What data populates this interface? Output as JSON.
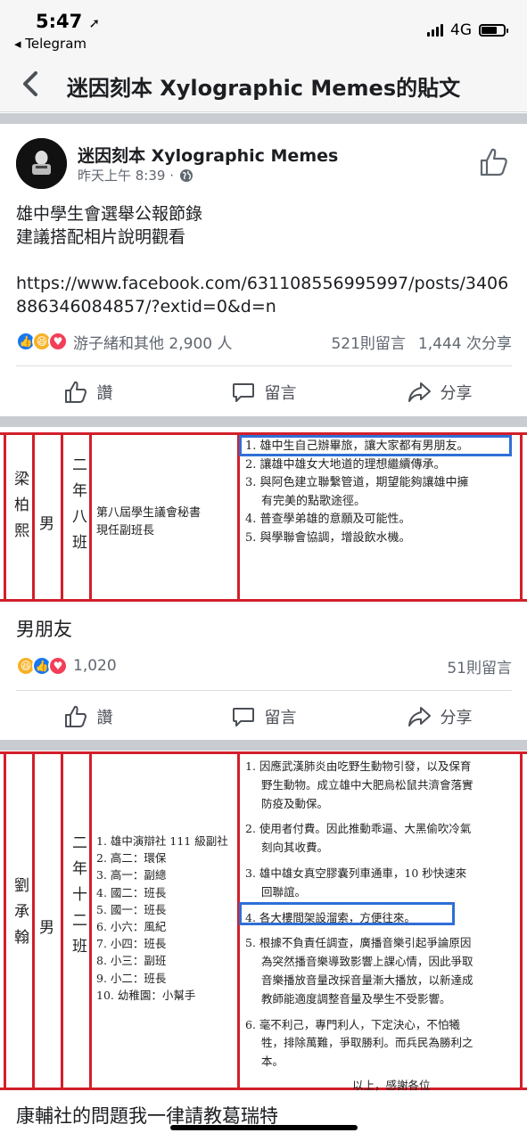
{
  "status": {
    "time": "5:47",
    "back_app": "◂ Telegram",
    "network": "4G"
  },
  "nav": {
    "title": "迷因刻本 Xylographic Memes的貼文"
  },
  "post": {
    "page_name": "迷因刻本 Xylographic Memes",
    "timestamp": "昨天上午 8:39 ·",
    "text_line1": "雄中學生會選舉公報節錄",
    "text_line2": "建議搭配相片說明觀看",
    "link": "https://www.facebook.com/631108556995997/posts/3406886346084857/?extid=0&d=n",
    "reactions_text": "游子緒和其他 2,900 人",
    "comments": "521則留言",
    "shares": "1,444 次分享"
  },
  "actions": {
    "like": "讚",
    "comment": "留言",
    "share": "分享"
  },
  "doc1": {
    "name": "梁柏熙",
    "gender": "男",
    "class": "二年八班",
    "roles": [
      "第八屆學生議會秘書",
      "現任副班長"
    ],
    "items": [
      "1. 雄中生自己辦畢旅，讓大家都有男朋友。",
      "2. 讓雄中雄女大地道的理想繼續傳承。",
      "3. 與阿色建立聯繫管道，期望能夠讓雄中擁",
      "有完美的點歌途徑。",
      "4. 普查學弟雄的意願及可能性。",
      "5. 與學聯會協調，增設飲水機。"
    ]
  },
  "photo1": {
    "caption": "男朋友",
    "reaction_count": "1,020",
    "comments": "51則留言"
  },
  "doc2": {
    "name": "劉承翰",
    "gender": "男",
    "class": "二年十二班",
    "roles": [
      "1. 雄中演辯社 111 級副社",
      "2. 高二：環保",
      "3. 高一：副總",
      "4. 國二：班長",
      "5. 國一：班長",
      "6. 小六：風紀",
      "7. 小四：班長",
      "8. 小三：副班",
      "9. 小二：班長",
      "10. 幼稚園：小幫手"
    ],
    "items": [
      "1. 因應武漢肺炎由吃野生動物引發，以及保育",
      "野生動物。成立雄中大肥烏松鼠共濟會落實",
      "防疫及動保。",
      "2. 使用者付費。因此推動乖逼、大黑偷吹冷氣",
      "刻向其收費。",
      "3. 雄中雄女真空膠囊列車通車，10 秒快速來",
      "回聯誼。",
      "4. 各大樓間架設溜索，方便往來。",
      "5. 根據不負責任調查，廣播音樂引起爭論原因",
      "為突然播音樂導致影響上課心情，因此爭取",
      "音樂播放音量改採音量漸大播放，以新達成",
      "教師能適度調整音量及學生不受影響。",
      "6. 毫不利己，專門利人，下定決心，不怕犧",
      "牲，排除萬難，爭取勝利。而兵民為勝利之",
      "本。",
      "以上，感謝各位"
    ]
  },
  "photo2": {
    "caption": "康輔社的問題我一律請教葛瑞特"
  }
}
